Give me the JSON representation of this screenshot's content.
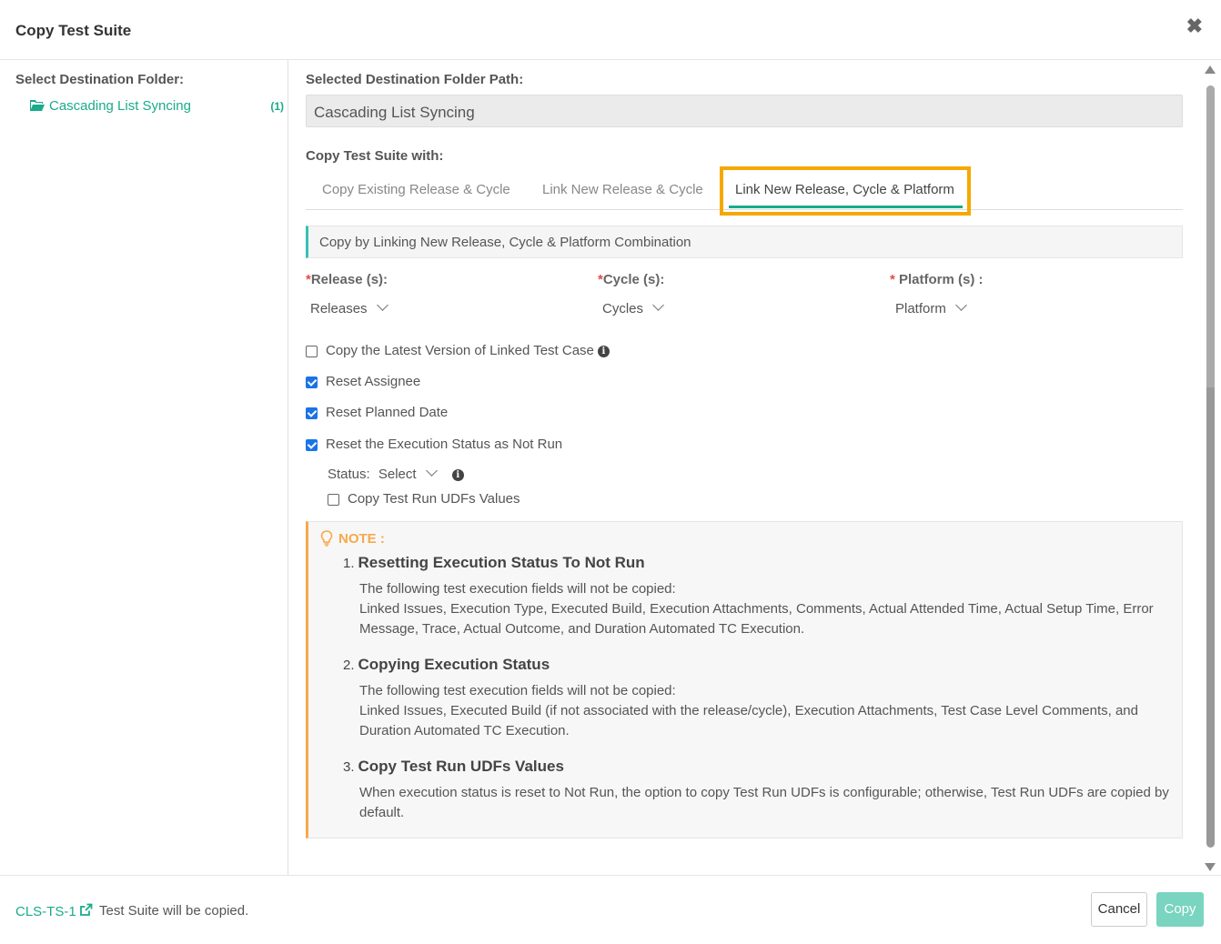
{
  "header": {
    "title": "Copy Test Suite",
    "close_icon": "close-icon"
  },
  "left_panel": {
    "title": "Select Destination Folder:",
    "folder": {
      "icon": "folder-open-icon",
      "label": "Cascading List Syncing",
      "count": "(1)"
    }
  },
  "main": {
    "path_label": "Selected Destination Folder Path:",
    "path_value": "Cascading List Syncing",
    "copy_with_label": "Copy Test Suite with:",
    "tabs": [
      {
        "label": "Copy Existing Release & Cycle",
        "active": false
      },
      {
        "label": "Link New Release & Cycle",
        "active": false
      },
      {
        "label": "Link New Release, Cycle & Platform",
        "active": true
      }
    ],
    "info_bar": "Copy by Linking New Release, Cycle & Platform Combination",
    "fields": {
      "release": {
        "required_mark": "*",
        "label": "Release (s):",
        "value": "Releases"
      },
      "cycle": {
        "required_mark": "*",
        "label": "Cycle (s):",
        "value": "Cycles"
      },
      "platform": {
        "required_mark": "*",
        "label": " Platform (s) :",
        "value": "Platform"
      }
    },
    "checkboxes": [
      {
        "label": "Copy the Latest Version of Linked Test Case",
        "checked": false,
        "has_info": true
      },
      {
        "label": "Reset Assignee",
        "checked": true
      },
      {
        "label": "Reset Planned Date",
        "checked": true
      },
      {
        "label": "Reset the Execution Status as Not Run",
        "checked": true
      }
    ],
    "status": {
      "label": "Status:",
      "value": "Select"
    },
    "copy_udfs": {
      "label": "Copy Test Run UDFs Values",
      "checked": false
    },
    "note": {
      "title": "NOTE :",
      "items": [
        {
          "num": "1.",
          "heading": "Resetting Execution Status To Not Run",
          "line1": "The following test execution fields will not be copied:",
          "line2": "Linked Issues, Execution Type, Executed Build, Execution Attachments, Comments, Actual Attended Time, Actual Setup Time, Error Message, Trace, Actual Outcome, and Duration Automated TC Execution."
        },
        {
          "num": "2.",
          "heading": "Copying Execution Status",
          "line1": "The following test execution fields will not be copied:",
          "line2": "Linked Issues, Executed Build (if not associated with the release/cycle), Execution Attachments, Test Case Level Comments, and Duration Automated TC Execution."
        },
        {
          "num": "3.",
          "heading": "Copy Test Run UDFs Values",
          "line1": "When execution status is reset to Not Run, the option to copy Test Run UDFs is configurable; otherwise, Test Run UDFs are copied by default."
        }
      ]
    }
  },
  "footer": {
    "link": "CLS-TS-1",
    "message": "Test Suite will be copied.",
    "cancel": "Cancel",
    "copy": "Copy"
  },
  "colors": {
    "accent": "#1aab8a",
    "highlight": "#f5a800",
    "note_accent": "#f7a94b",
    "required": "#e24c4c",
    "checkbox": "#1a73e8"
  }
}
